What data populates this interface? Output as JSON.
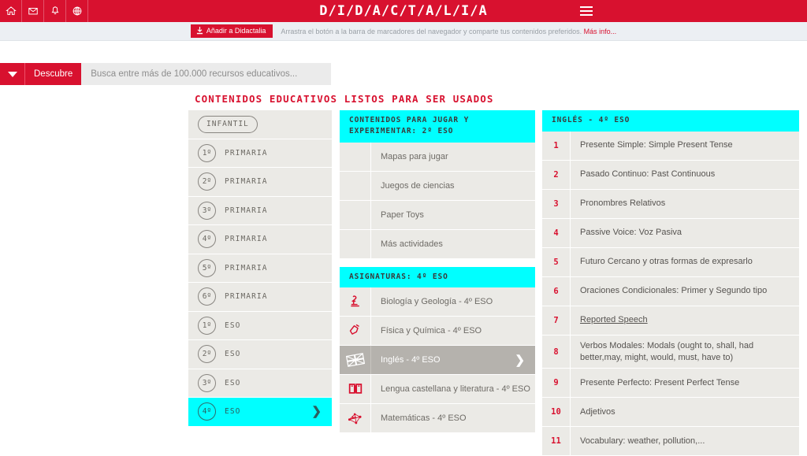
{
  "topbar": {
    "icons": [
      {
        "name": "home-icon",
        "label": "Inicio"
      },
      {
        "name": "mail-icon",
        "label": "Mensajes"
      },
      {
        "name": "bell-icon",
        "label": "Notificaciones"
      },
      {
        "name": "globe-icon",
        "label": "Idioma"
      }
    ],
    "logo": "D/I/D/A/C/T/A/L/I/A",
    "menu_label": "Menú"
  },
  "bookmarklet": {
    "button_label": "Añadir a Didactalia",
    "text": "Arrastra el botón a la barra de marcadores del navegador y comparte tus contenidos preferidos.",
    "more_link": "Más info..."
  },
  "search": {
    "discover_label": "Descubre",
    "placeholder": "Busca entre más de 100.000 recursos educativos...",
    "value": ""
  },
  "page_title": "CONTENIDOS EDUCATIVOS LISTOS PARA SER USADOS",
  "levels": [
    {
      "badge": "INFANTIL",
      "label": "",
      "pill": true,
      "selected": false
    },
    {
      "badge": "1º",
      "label": "PRIMARIA",
      "pill": false,
      "selected": false
    },
    {
      "badge": "2º",
      "label": "PRIMARIA",
      "pill": false,
      "selected": false
    },
    {
      "badge": "3º",
      "label": "PRIMARIA",
      "pill": false,
      "selected": false
    },
    {
      "badge": "4º",
      "label": "PRIMARIA",
      "pill": false,
      "selected": false
    },
    {
      "badge": "5º",
      "label": "PRIMARIA",
      "pill": false,
      "selected": false
    },
    {
      "badge": "6º",
      "label": "PRIMARIA",
      "pill": false,
      "selected": false
    },
    {
      "badge": "1º",
      "label": "ESO",
      "pill": false,
      "selected": false
    },
    {
      "badge": "2º",
      "label": "ESO",
      "pill": false,
      "selected": false
    },
    {
      "badge": "3º",
      "label": "ESO",
      "pill": false,
      "selected": false
    },
    {
      "badge": "4º",
      "label": "ESO",
      "pill": false,
      "selected": true,
      "chevron": "❯"
    }
  ],
  "middle": {
    "games_header": "CONTENIDOS PARA JUGAR Y EXPERIMENTAR: 2º ESO",
    "games": [
      {
        "label": "Mapas para jugar",
        "icon": ""
      },
      {
        "label": "Juegos de ciencias",
        "icon": ""
      },
      {
        "label": "Paper Toys",
        "icon": ""
      },
      {
        "label": "Más actividades",
        "icon": ""
      }
    ],
    "subjects_header": "ASIGNATURAS: 4º ESO",
    "subjects": [
      {
        "label": "Biología y Geología - 4º ESO",
        "icon": "microscope-icon",
        "selected": false
      },
      {
        "label": "Física y Química - 4º ESO",
        "icon": "flask-icon",
        "selected": false
      },
      {
        "label": "Inglés - 4º ESO",
        "icon": "uk-flag-icon",
        "selected": true,
        "chevron": "❯"
      },
      {
        "label": "Lengua castellana y literatura - 4º ESO",
        "icon": "open-book-icon",
        "selected": false
      },
      {
        "label": "Matemáticas - 4º ESO",
        "icon": "graph-network-icon",
        "selected": false
      }
    ]
  },
  "right": {
    "header": "INGLÉS - 4º ESO",
    "items": [
      {
        "num": "1",
        "label": "Presente Simple: Simple Present Tense",
        "hover": false
      },
      {
        "num": "2",
        "label": "Pasado Continuo: Past Continuous",
        "hover": false
      },
      {
        "num": "3",
        "label": "Pronombres Relativos",
        "hover": false
      },
      {
        "num": "4",
        "label": "Passive Voice: Voz Pasiva",
        "hover": false
      },
      {
        "num": "5",
        "label": "Futuro Cercano y otras formas de expresarlo",
        "hover": false
      },
      {
        "num": "6",
        "label": "Oraciones Condicionales: Primer y Segundo tipo",
        "hover": false
      },
      {
        "num": "7",
        "label": "Reported Speech",
        "hover": true
      },
      {
        "num": "8",
        "label": "Verbos Modales: Modals (ought to, shall, had better,may, might, would, must, have to)",
        "hover": false
      },
      {
        "num": "9",
        "label": "Presente Perfecto: Present Perfect Tense",
        "hover": false
      },
      {
        "num": "10",
        "label": "Adjetivos",
        "hover": false
      },
      {
        "num": "11",
        "label": "Vocabulary: weather, pollution,...",
        "hover": false
      }
    ]
  },
  "colors": {
    "brand_red": "#d8112f",
    "accent_cyan": "#00ffff",
    "row_gray": "#ebeae6",
    "selected_gray": "#b5b2ad"
  }
}
